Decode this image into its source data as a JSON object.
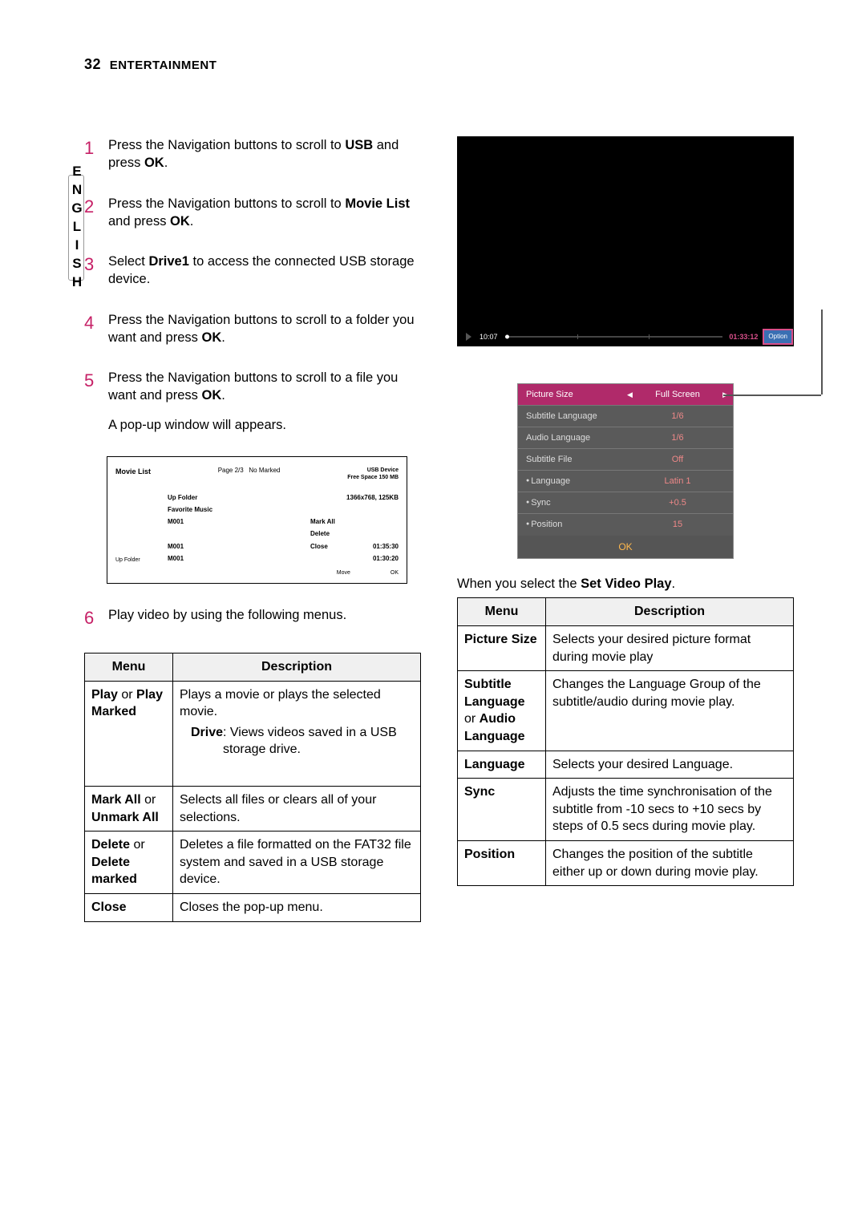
{
  "header": {
    "page": "32",
    "section": "ENTERTAINMENT"
  },
  "sidetab": "ENGLISH",
  "steps": [
    {
      "n": "1",
      "pre": "Press the Navigation buttons to scroll to ",
      "b1": "USB",
      "mid": " and press ",
      "b2": "OK",
      "post": "."
    },
    {
      "n": "2",
      "pre": "Press the Navigation buttons to scroll to ",
      "b1": "Movie List",
      "mid": " and press ",
      "b2": "OK",
      "post": "."
    },
    {
      "n": "3",
      "pre": "Select ",
      "b1": "Drive1",
      "mid": " to access the connected USB storage device.",
      "b2": "",
      "post": ""
    },
    {
      "n": "4",
      "pre": "Press the Navigation buttons to scroll to a folder you want and press ",
      "b1": "OK",
      "mid": ".",
      "b2": "",
      "post": ""
    },
    {
      "n": "5",
      "pre": "Press the Navigation buttons to scroll to a file you want and press ",
      "b1": "OK",
      "mid": ".",
      "b2": "",
      "post": "",
      "sub": "A pop-up window will appears."
    },
    {
      "n": "6",
      "pre": "Play video by using the following menus.",
      "b1": "",
      "mid": "",
      "b2": "",
      "post": ""
    }
  ],
  "movielist": {
    "title": "Movie List",
    "page": "Page 2/3",
    "marked": "No Marked",
    "usb": "USB Device",
    "free": "Free Space 150 MB",
    "upfolder_btm": "Up Folder",
    "mid": [
      "Up Folder",
      "Favorite Music",
      "M001",
      "",
      "M001",
      "M001"
    ],
    "right_top": "1366x768, 125KB",
    "right_menu": [
      "Mark All",
      "Delete"
    ],
    "right_close": {
      "label": "Close",
      "t1": "01:35:30",
      "t2": "01:30:20"
    },
    "foot": {
      "l": "Move",
      "r": "OK"
    }
  },
  "table1": {
    "head": {
      "menu": "Menu",
      "desc": "Description"
    },
    "rows": [
      {
        "menu_html": "<b>Play</b> or <b>Play Marked</b>",
        "desc": "Plays a movie or plays the selected movie.",
        "bullet_b": "Drive",
        "bullet_rest": ": Views videos saved in a USB storage drive."
      },
      {
        "menu_html": "<b>Mark All</b> or <b>Unmark All</b>",
        "desc": "Selects all files or clears all of your selections."
      },
      {
        "menu_html": "<b>Delete</b> or <b>Delete marked</b>",
        "desc": "Deletes a file formatted on the FAT32 file system and saved in a USB storage device."
      },
      {
        "menu_html": "<b>Close</b>",
        "desc": "Closes the pop-up menu."
      }
    ]
  },
  "screen": {
    "tleft": "10:07",
    "tright": "01:33:12",
    "option": "Option"
  },
  "options": {
    "rows": [
      {
        "label": "Picture Size",
        "val": "Full Screen",
        "sel": true,
        "arrows": true
      },
      {
        "label": "Subtitle Language",
        "val": "1/6"
      },
      {
        "label": "Audio Language",
        "val": "1/6"
      },
      {
        "label": "Subtitle File",
        "val": "Off"
      },
      {
        "label": "Language",
        "val": "Latin 1",
        "bullet": true
      },
      {
        "label": "Sync",
        "val": "+0.5",
        "bullet": true
      },
      {
        "label": "Position",
        "val": "15",
        "bullet": true
      }
    ],
    "ok": "OK"
  },
  "rc_caption": {
    "pre": "When you select the ",
    "b": "Set Video Play",
    "post": "."
  },
  "table2": {
    "head": {
      "menu": "Menu",
      "desc": "Description"
    },
    "rows": [
      {
        "menu_html": "<b>Picture Size</b>",
        "desc": "Selects your desired picture format during movie play"
      },
      {
        "menu_html": "<b>Subtitle Language</b> or <b>Audio Language</b>",
        "desc": "Changes the Language Group of the subtitle/audio during movie play."
      },
      {
        "menu_html": "<b>Language</b>",
        "desc": "Selects your desired Language."
      },
      {
        "menu_html": "<b>Sync</b>",
        "desc": "Adjusts the time synchronisation of the subtitle from -10 secs to +10 secs by steps of 0.5 secs during movie play."
      },
      {
        "menu_html": "<b>Position</b>",
        "desc": "Changes the position of the subtitle either up or down during movie play."
      }
    ]
  }
}
